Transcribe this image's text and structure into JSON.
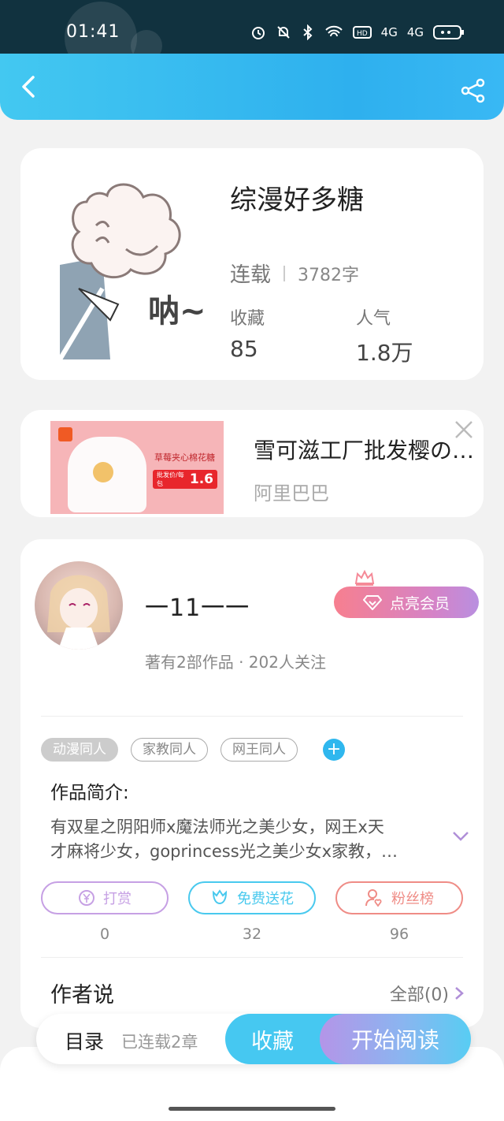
{
  "status_bar": {
    "time": "01:41",
    "network_a": "4G",
    "network_b": "4G"
  },
  "book": {
    "title": "综漫好多糖",
    "cover_text": "呐~",
    "status": "连载",
    "word_count": "3782字",
    "favorites_label": "收藏",
    "favorites_value": "85",
    "popularity_label": "人气",
    "popularity_value": "1.8万"
  },
  "ad": {
    "title": "雪可滋工厂批发樱の雪…",
    "source": "阿里巴巴",
    "image_caption": "草莓夹心棉花糖",
    "image_price": "1.6",
    "image_price_note": "批发价/每包"
  },
  "author": {
    "name": "一11一一",
    "vip_label": "点亮会员",
    "meta": "著有2部作品 · 202人关注",
    "tags": [
      "动漫同人",
      "家教同人",
      "网王同人"
    ],
    "intro_label": "作品简介:",
    "intro_line1": "有双星之阴阳师x魔法师光之美少女，网王x天",
    "intro_line2": "才麻将少女，goprincess光之美少女x家教，…",
    "actions": [
      {
        "label": "打赏",
        "count": "0",
        "color": "#c6a0e4"
      },
      {
        "label": "免费送花",
        "count": "32",
        "color": "#49c9ee"
      },
      {
        "label": "粉丝榜",
        "count": "96",
        "color": "#ef8c86"
      }
    ],
    "says_label": "作者说",
    "says_all": "全部(0)"
  },
  "bottom_bar": {
    "toc_label": "目录",
    "chapters": "已连载2章",
    "favorite_button": "收藏",
    "read_button": "开始阅读"
  },
  "colors": {
    "header": "#2eb0ee",
    "accent": "#46c8f1",
    "vip": "#f77f8f"
  }
}
